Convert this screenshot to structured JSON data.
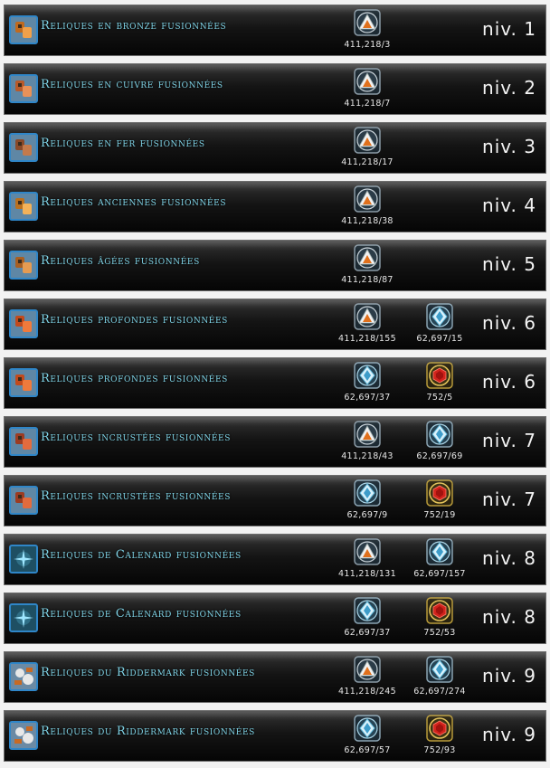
{
  "rows": [
    {
      "name": "Reliques en bronze fusionnées",
      "level": "niv. 1",
      "icon": "bronze-relic-icon",
      "costs": [
        {
          "token": "shard-token-icon",
          "qty": "411,218/3"
        }
      ]
    },
    {
      "name": "Reliques en cuivre fusionnées",
      "level": "niv. 2",
      "icon": "copper-relic-icon",
      "costs": [
        {
          "token": "shard-token-icon",
          "qty": "411,218/7"
        }
      ]
    },
    {
      "name": "Reliques en fer fusionnées",
      "level": "niv. 3",
      "icon": "iron-relic-icon",
      "costs": [
        {
          "token": "shard-token-icon",
          "qty": "411,218/17"
        }
      ]
    },
    {
      "name": "Reliques anciennes fusionnées",
      "level": "niv. 4",
      "icon": "ancient-relic-icon",
      "costs": [
        {
          "token": "shard-token-icon",
          "qty": "411,218/38"
        }
      ]
    },
    {
      "name": "Reliques âgées fusionnées",
      "level": "niv. 5",
      "icon": "aged-relic-icon",
      "costs": [
        {
          "token": "shard-token-icon",
          "qty": "411,218/87"
        }
      ]
    },
    {
      "name": "Reliques profondes fusionnées",
      "level": "niv. 6",
      "icon": "deep-relic-icon",
      "costs": [
        {
          "token": "shard-token-icon",
          "qty": "411,218/155"
        },
        {
          "token": "crystal-token-icon",
          "qty": "62,697/15"
        }
      ]
    },
    {
      "name": "Reliques profondes fusionnées",
      "level": "niv. 6",
      "icon": "deep-relic-icon",
      "costs": [
        {
          "token": "crystal-token-icon",
          "qty": "62,697/37"
        },
        {
          "token": "ruby-token-icon",
          "qty": "752/5"
        }
      ]
    },
    {
      "name": "Reliques incrustées fusionnées",
      "level": "niv. 7",
      "icon": "inlaid-relic-icon",
      "costs": [
        {
          "token": "shard-token-icon",
          "qty": "411,218/43"
        },
        {
          "token": "crystal-token-icon",
          "qty": "62,697/69"
        }
      ]
    },
    {
      "name": "Reliques incrustées fusionnées",
      "level": "niv. 7",
      "icon": "inlaid-relic-icon",
      "costs": [
        {
          "token": "crystal-token-icon",
          "qty": "62,697/9"
        },
        {
          "token": "ruby-token-icon",
          "qty": "752/19"
        }
      ]
    },
    {
      "name": "Reliques de Calenard fusionnées",
      "level": "niv. 8",
      "icon": "calenard-relic-icon",
      "costs": [
        {
          "token": "shard-token-icon",
          "qty": "411,218/131"
        },
        {
          "token": "crystal-token-icon",
          "qty": "62,697/157"
        }
      ]
    },
    {
      "name": "Reliques de Calenard fusionnées",
      "level": "niv. 8",
      "icon": "calenard-relic-icon",
      "costs": [
        {
          "token": "crystal-token-icon",
          "qty": "62,697/37"
        },
        {
          "token": "ruby-token-icon",
          "qty": "752/53"
        }
      ]
    },
    {
      "name": "Reliques du Riddermark fusionnées",
      "level": "niv. 9",
      "icon": "riddermark-relic-icon",
      "costs": [
        {
          "token": "shard-token-icon",
          "qty": "411,218/245"
        },
        {
          "token": "crystal-token-icon",
          "qty": "62,697/274"
        }
      ]
    },
    {
      "name": "Reliques du Riddermark fusionnées",
      "level": "niv. 9",
      "icon": "riddermark-relic-icon",
      "costs": [
        {
          "token": "crystal-token-icon",
          "qty": "62,697/57"
        },
        {
          "token": "ruby-token-icon",
          "qty": "752/93"
        }
      ]
    }
  ],
  "colors": {
    "name_text": "#7fd3e6",
    "icon_border": "#2f86c8",
    "qty_text": "#e6e6e6",
    "level_text": "#f4f4f4"
  }
}
